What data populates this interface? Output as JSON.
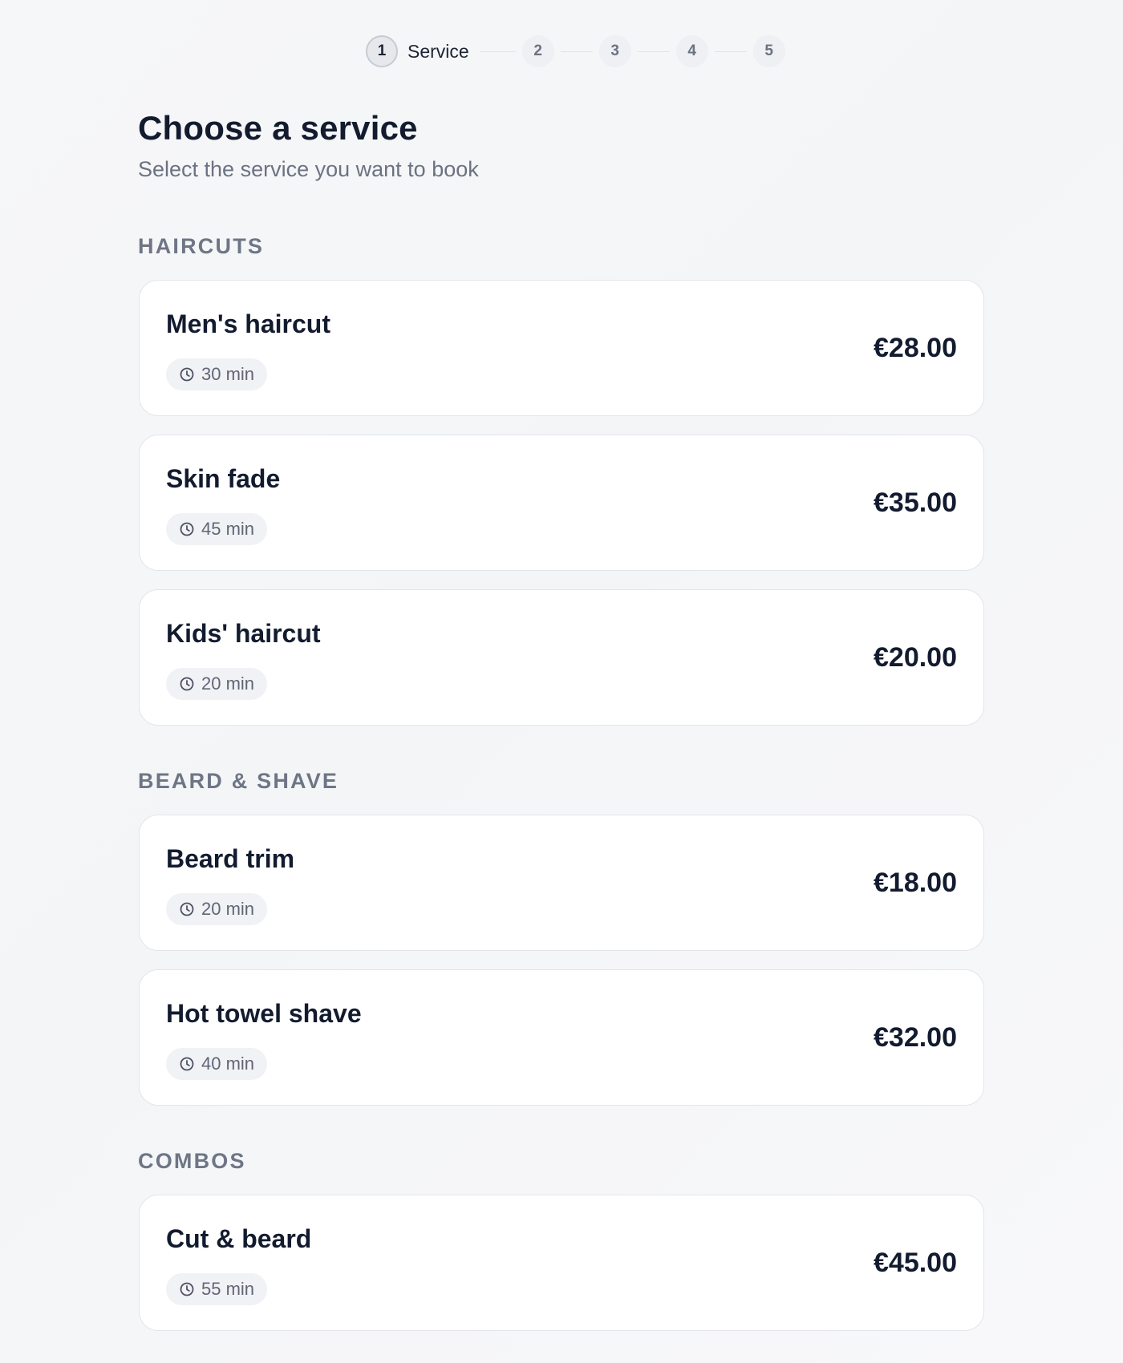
{
  "stepper": {
    "steps": [
      {
        "number": "1",
        "label": "Service"
      },
      {
        "number": "2"
      },
      {
        "number": "3"
      },
      {
        "number": "4"
      },
      {
        "number": "5"
      }
    ],
    "active_step": 1
  },
  "header": {
    "title": "Choose a service",
    "subtitle": "Select the service you want to book"
  },
  "sections": [
    {
      "title": "HAIRCUTS",
      "services": [
        {
          "name": "Men's haircut",
          "duration": "30 min",
          "price": "€28.00"
        },
        {
          "name": "Skin fade",
          "duration": "45 min",
          "price": "€35.00"
        },
        {
          "name": "Kids' haircut",
          "duration": "20 min",
          "price": "€20.00"
        }
      ]
    },
    {
      "title": "BEARD & SHAVE",
      "services": [
        {
          "name": "Beard trim",
          "duration": "20 min",
          "price": "€18.00"
        },
        {
          "name": "Hot towel shave",
          "duration": "40 min",
          "price": "€32.00"
        }
      ]
    },
    {
      "title": "COMBOS",
      "services": [
        {
          "name": "Cut & beard",
          "duration": "55 min",
          "price": "€45.00"
        }
      ]
    }
  ],
  "icons": {
    "duration": "clock-icon"
  },
  "colors": {
    "text_primary": "#131b2f",
    "text_muted": "#6b7282",
    "card_background": "#ffffff",
    "card_border": "#e2e5ea",
    "page_background": "#f5f6f8"
  }
}
